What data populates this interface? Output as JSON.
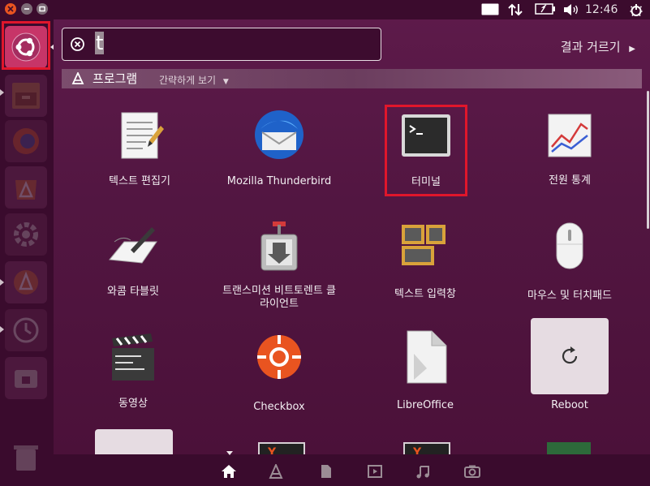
{
  "clock": "12:46",
  "search": {
    "query": "t"
  },
  "filter_results_label": "결과 거르기",
  "category": {
    "title": "프로그램",
    "view_link": "간략하게 보기"
  },
  "apps": [
    {
      "label": "텍스트 편집기",
      "icon": "text-editor-icon"
    },
    {
      "label": "Mozilla Thunderbird",
      "icon": "thunderbird-icon"
    },
    {
      "label": "터미널",
      "icon": "terminal-icon"
    },
    {
      "label": "전원 통계",
      "icon": "power-statistics-icon"
    },
    {
      "label": "와콤 타블릿",
      "icon": "wacom-tablet-icon"
    },
    {
      "label": "트랜스미션 비트토렌트 클라이언트",
      "icon": "transmission-icon"
    },
    {
      "label": "텍스트 입력창",
      "icon": "text-entry-icon"
    },
    {
      "label": "마우스 및 터치패드",
      "icon": "mouse-icon"
    },
    {
      "label": "동영상",
      "icon": "videos-icon"
    },
    {
      "label": "Checkbox",
      "icon": "checkbox-icon"
    },
    {
      "label": "LibreOffice",
      "icon": "libreoffice-icon"
    },
    {
      "label": "Reboot",
      "icon": "reboot-icon"
    }
  ],
  "colors": {
    "accent": "#e95420",
    "selection": "#e0162b",
    "panel": "#3b0b2d"
  }
}
